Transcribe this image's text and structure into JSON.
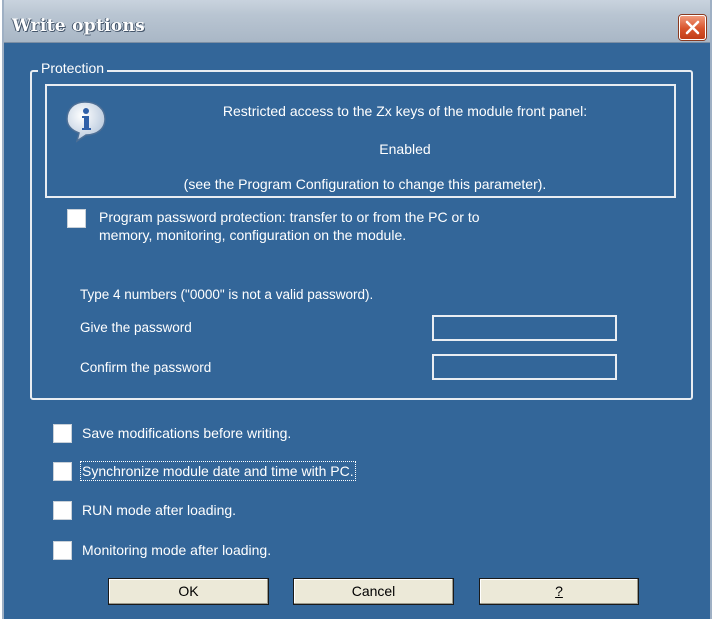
{
  "window": {
    "title": "Write options",
    "close_icon": "close-icon"
  },
  "protection": {
    "group_label": "Protection",
    "info_icon": "info-icon",
    "info_line1": "Restricted access to the Zx keys of the module front panel:",
    "info_line2": "Enabled",
    "info_line3": "(see the Program Configuration to change this parameter).",
    "password_protection_label_line1": "Program password protection: transfer to or from the PC or to",
    "password_protection_label_line2": "memory, monitoring, configuration on the module.",
    "password_protection_checked": false,
    "instruction": "Type 4 numbers (\"0000\" is not a valid password).",
    "give_password_label": "Give the password",
    "give_password_value": "",
    "confirm_password_label": "Confirm the password",
    "confirm_password_value": ""
  },
  "options": [
    {
      "label": "Save modifications before writing.",
      "checked": false
    },
    {
      "label": "Synchronize module date and time with PC.",
      "checked": false
    },
    {
      "label": "RUN mode after loading.",
      "checked": false
    },
    {
      "label": "Monitoring mode after loading.",
      "checked": false
    }
  ],
  "buttons": {
    "ok": "OK",
    "cancel": "Cancel",
    "help": "?"
  },
  "colors": {
    "dialog_background": "#336699",
    "close_button": "#d8542c"
  }
}
